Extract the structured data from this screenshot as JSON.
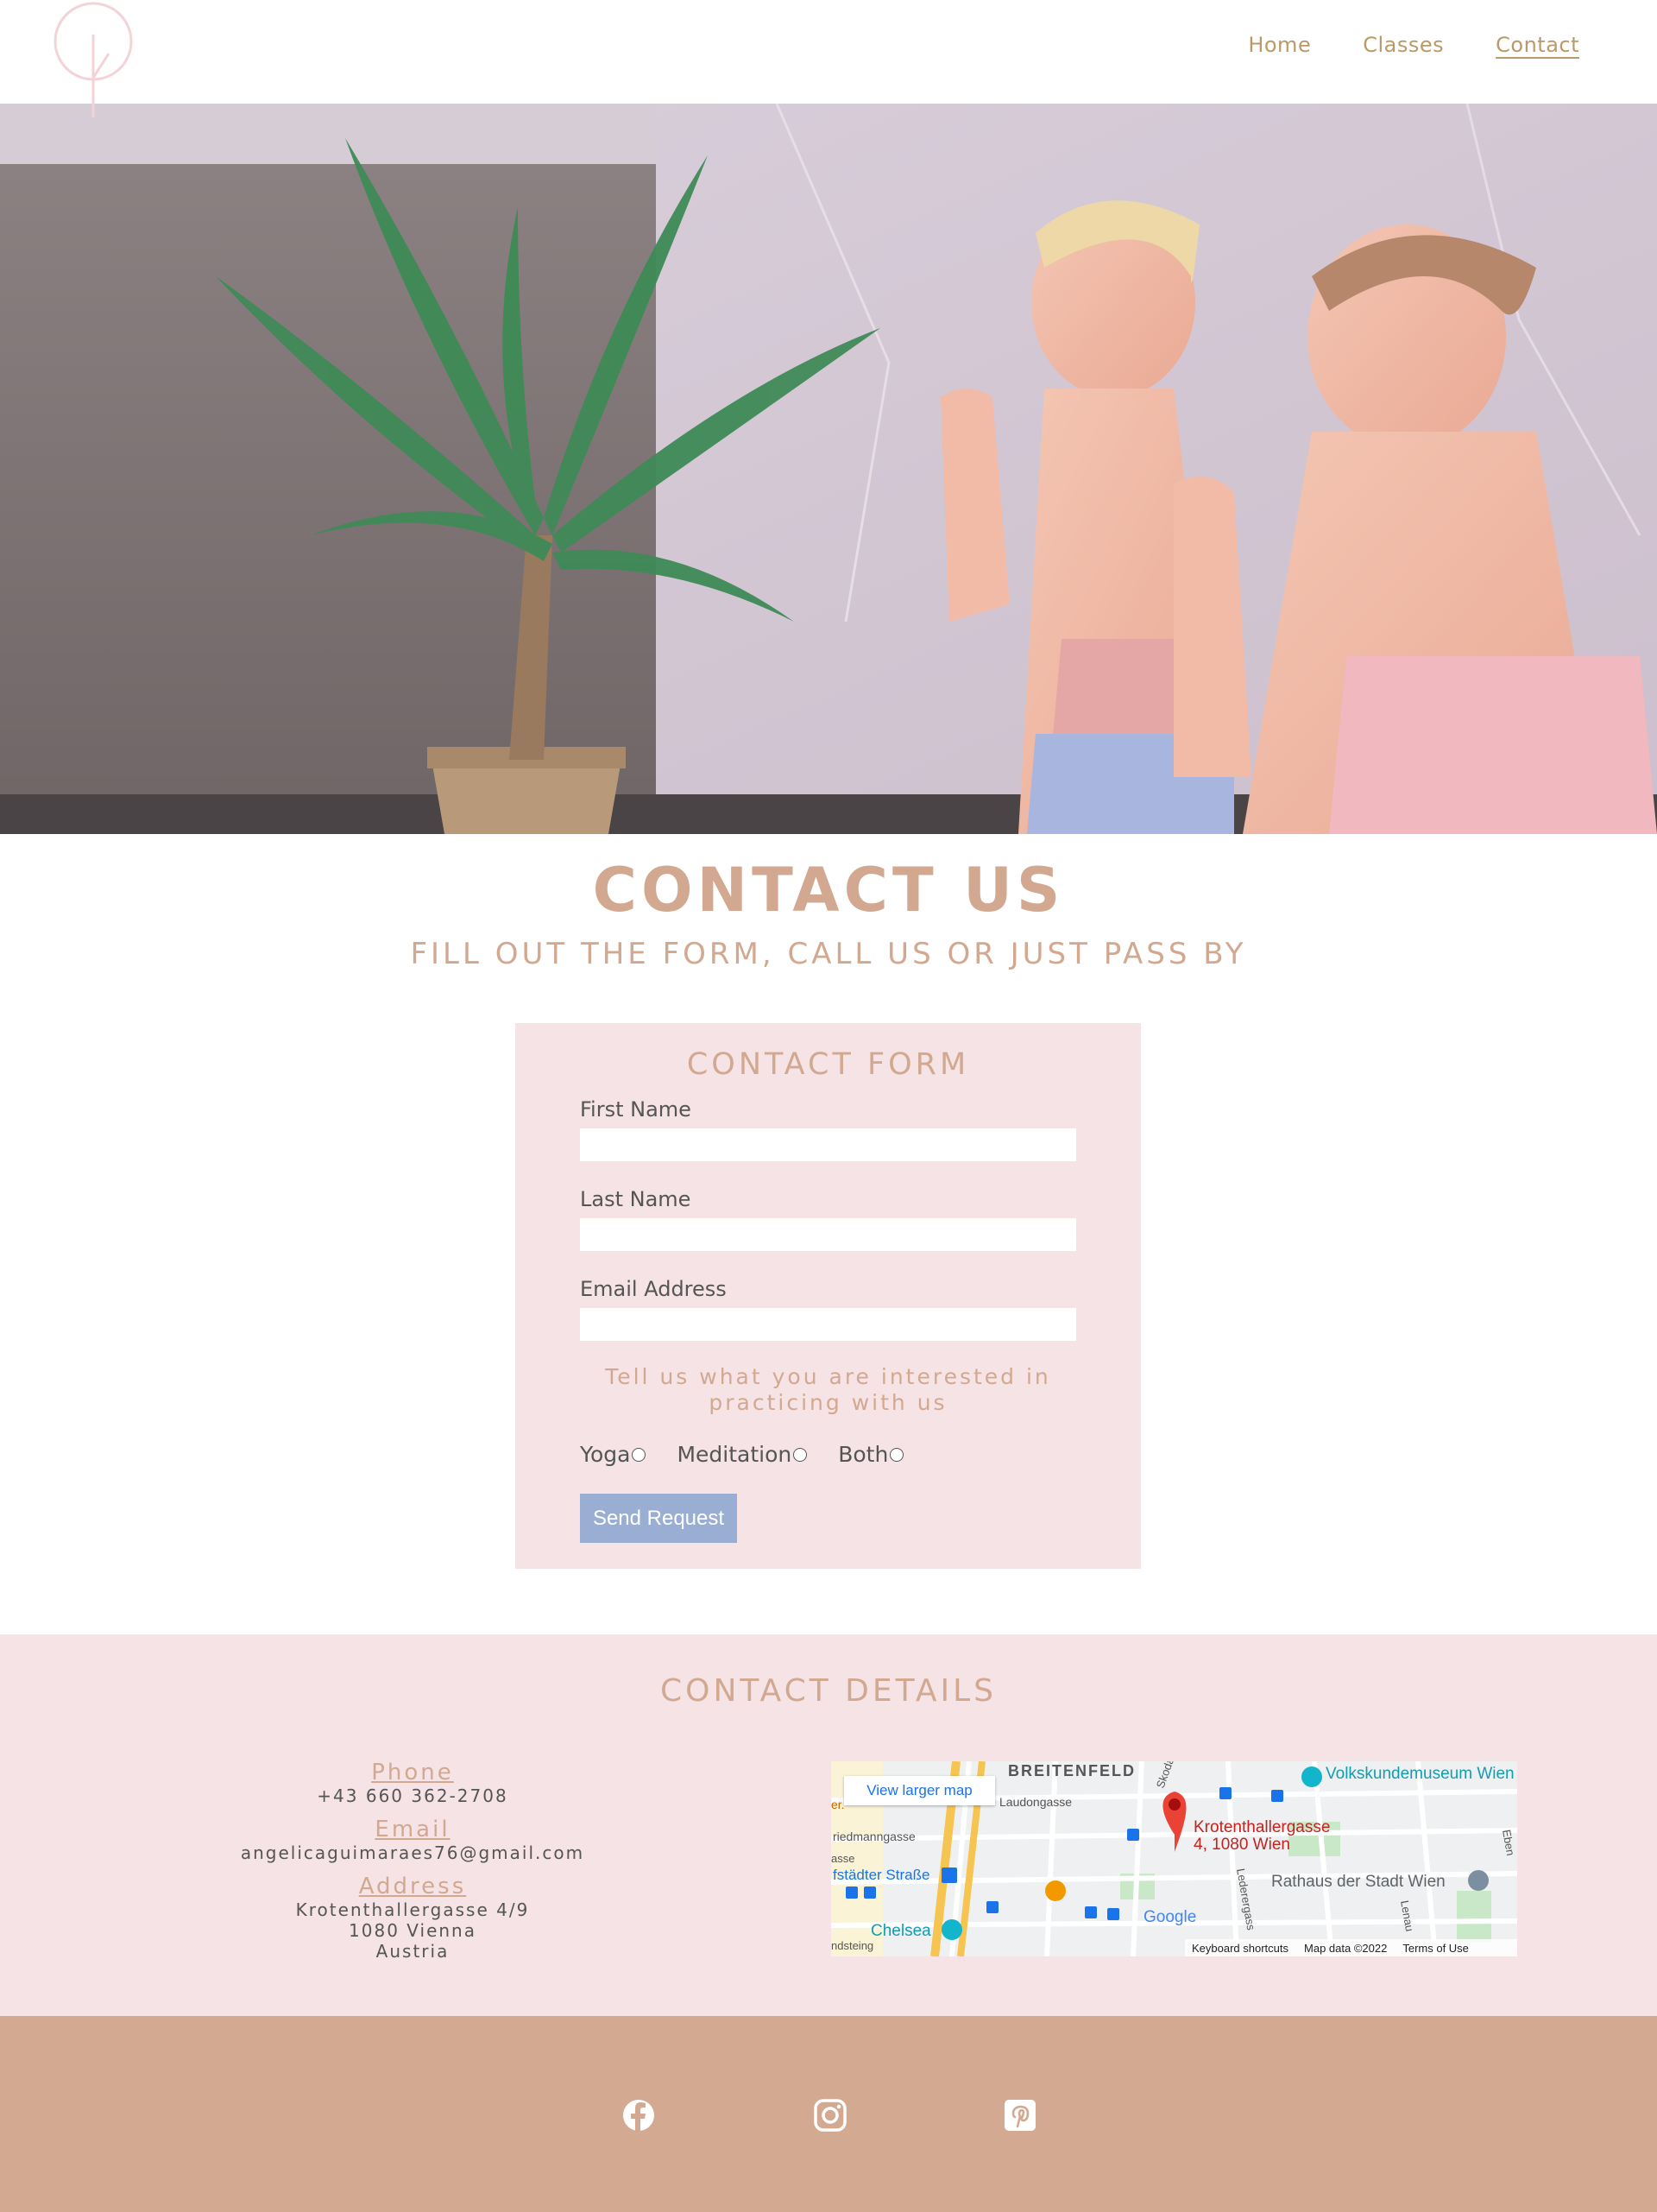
{
  "nav": {
    "home": "Home",
    "classes": "Classes",
    "contact": "Contact"
  },
  "hero": {
    "icon": "yoga-hero-photo"
  },
  "page": {
    "title": "CONTACT US",
    "subtitle": "FILL OUT THE FORM, CALL US OR JUST PASS BY"
  },
  "form": {
    "title": "CONTACT FORM",
    "first_name_label": "First Name",
    "first_name_value": "",
    "last_name_label": "Last Name",
    "last_name_value": "",
    "email_label": "Email Address",
    "email_value": "",
    "interest_prompt": "Tell us what you are interested in practicing with us",
    "options": [
      "Yoga",
      "Meditation",
      "Both"
    ],
    "submit_label": "Send Request"
  },
  "details": {
    "title": "CONTACT DETAILS",
    "phone_label": "Phone",
    "phone_value": "+43 660 362-2708",
    "email_label": "Email",
    "email_value": "angelicaguimaraes76@gmail.com",
    "address_label": "Address",
    "address_line1": "Krotenthallergasse 4/9",
    "address_line2": "1080 Vienna",
    "address_line3": "Austria"
  },
  "map": {
    "view_larger": "View larger map",
    "district": "BREITENFELD",
    "museum": "Volkskundemuseum Wien",
    "pin_line1": "Krotenthallergasse",
    "pin_line2": "4, 1080 Wien",
    "street_laudon": "Laudongasse",
    "street_friedmann": "riedmanngasse",
    "street_josef": "fstädter Straße",
    "street_skoda": "Skodag",
    "street_leder": "Lederergass",
    "street_lenau": "Lenau",
    "street_eben": "Eben",
    "street_ndstein": "ndsteing",
    "street_er": "er.",
    "street_asse": "asse",
    "rathaus": "Rathaus der Stadt Wien",
    "chelsea": "Chelsea",
    "google": "Google",
    "shortcuts": "Keyboard shortcuts",
    "mapdata": "Map data ©2022",
    "terms": "Terms of Use"
  },
  "colors": {
    "accent": "#d2a990",
    "nav": "#b99a68",
    "pink_bg": "#f5e3e5",
    "button": "#9aaed4",
    "footer": "#d3aa91"
  },
  "icons": {
    "logo": "tree-logo-icon",
    "social": [
      "facebook-icon",
      "instagram-icon",
      "pinterest-icon"
    ]
  }
}
